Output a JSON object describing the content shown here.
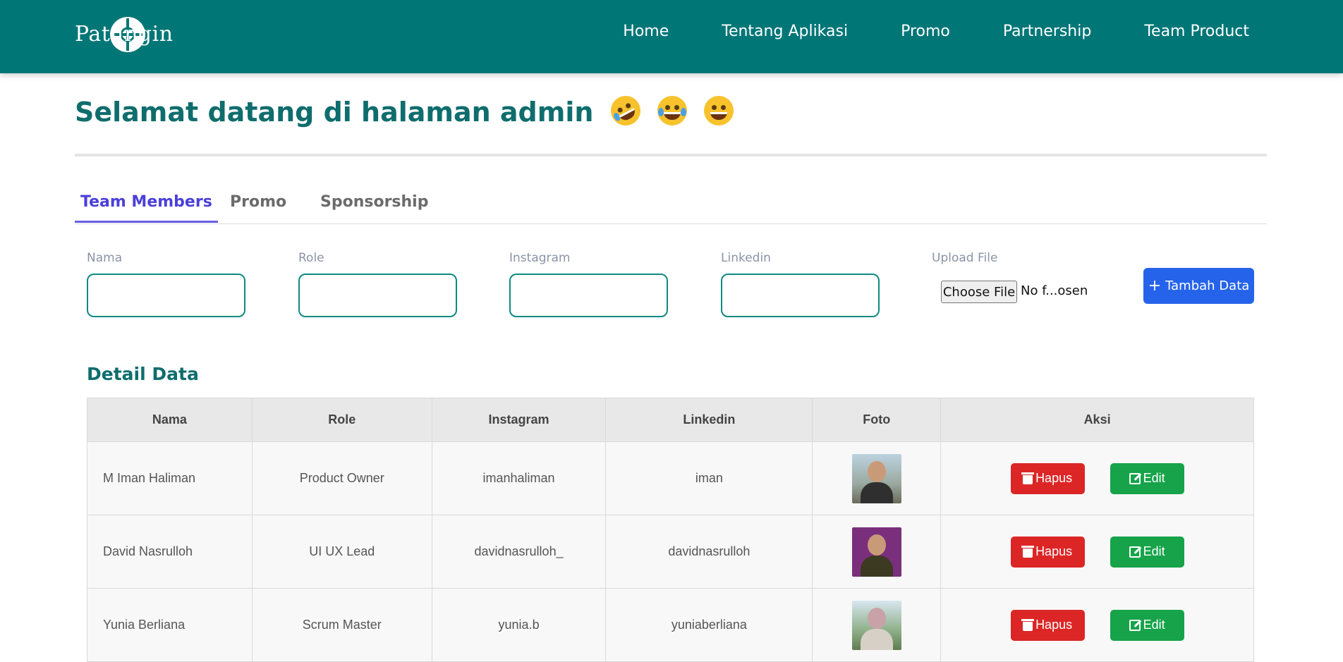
{
  "brand": {
    "name": "Patungin"
  },
  "nav": [
    "Home",
    "Tentang Aplikasi",
    "Promo",
    "Partnership",
    "Team Product"
  ],
  "page_title": "Selamat datang di halaman admin",
  "emojis": [
    "rolling-on-floor-laughing",
    "face-with-tears-of-joy",
    "grinning-face"
  ],
  "tabs": [
    {
      "label": "Team Members",
      "active": true
    },
    {
      "label": "Promo",
      "active": false
    },
    {
      "label": "Sponsorship",
      "active": false
    }
  ],
  "form": {
    "fields": [
      {
        "label": "Nama",
        "value": ""
      },
      {
        "label": "Role",
        "value": ""
      },
      {
        "label": "Instagram",
        "value": ""
      },
      {
        "label": "Linkedin",
        "value": ""
      }
    ],
    "upload_label": "Upload File",
    "file_button": "Choose File",
    "file_status": "No f...osen",
    "add_button": "Tambah Data"
  },
  "detail": {
    "title": "Detail Data",
    "columns": [
      "Nama",
      "Role",
      "Instagram",
      "Linkedin",
      "Foto",
      "Aksi"
    ],
    "rows": [
      {
        "nama": "M Iman Haliman",
        "role": "Product Owner",
        "instagram": "imanhaliman",
        "linkedin": "iman"
      },
      {
        "nama": "David Nasrulloh",
        "role": "UI UX Lead",
        "instagram": "davidnasrulloh_",
        "linkedin": "davidnasrulloh"
      },
      {
        "nama": "Yunia Berliana",
        "role": "Scrum Master",
        "instagram": "yunia.b",
        "linkedin": "yuniaberliana"
      }
    ],
    "delete_label": "Hapus",
    "edit_label": "Edit"
  },
  "colors": {
    "navbar": "#007677",
    "title": "#0f6d6d",
    "active_tab": "#4b40d8",
    "add_button": "#2563eb",
    "delete_button": "#dc2626",
    "edit_button": "#16a34a"
  }
}
